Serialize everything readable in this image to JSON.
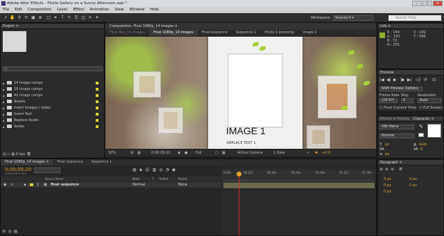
{
  "app": {
    "title": "Adobe After Effects - Photo Gallery on a Sunny Afternoon.aep *",
    "logo_text": "Ae",
    "window_buttons": [
      "–",
      "□",
      "✕"
    ]
  },
  "menu": [
    "File",
    "Edit",
    "Composition",
    "Layer",
    "Effect",
    "Animation",
    "View",
    "Window",
    "Help"
  ],
  "toolbar": {
    "tools": [
      "arrow-tool-icon",
      "hand-tool-icon",
      "zoom-tool-icon",
      "rotate-tool-icon",
      "camera-tool-icon",
      "pan-tool-icon",
      "rect-tool-icon",
      "pen-tool-icon",
      "type-tool-icon",
      "brush-tool-icon",
      "clone-tool-icon",
      "eraser-tool-icon",
      "roto-tool-icon",
      "puppet-tool-icon"
    ],
    "workspace_label": "Workspace:",
    "workspace_value": "Standard",
    "search_placeholder": "Search Help"
  },
  "project": {
    "tab": "Project ×",
    "items": [
      {
        "label": "14 image comps",
        "type": "folder"
      },
      {
        "label": "28 image comps",
        "type": "folder"
      },
      {
        "label": "42 image comps",
        "type": "folder"
      },
      {
        "label": "Assets",
        "type": "folder"
      },
      {
        "label": "Insert Images / video",
        "type": "folder"
      },
      {
        "label": "Insert Text",
        "type": "folder"
      },
      {
        "label": "Replace Audio",
        "type": "folder"
      },
      {
        "label": "Solids",
        "type": "folder"
      }
    ],
    "bpc": "8 bpc"
  },
  "composition": {
    "panel_tab": "Composition: Final 1080p_14 images ×",
    "tabs": [
      {
        "label": "Final 4kp_14 images",
        "active": false
      },
      {
        "label": "Final 1080p_14 images",
        "active": true
      },
      {
        "label": "Final sequence",
        "active": false
      },
      {
        "label": "Sequence 1",
        "active": false
      },
      {
        "label": "Photo 1 precomp",
        "active": false
      },
      {
        "label": "Image 1",
        "active": false
      }
    ],
    "image_title": "IMAGE 1",
    "image_subtitle": "REPLACE TEXT 1",
    "viewer_bar": {
      "zoom": "50%",
      "timecode": "0;00;09;20",
      "resolution": "Full",
      "camera": "Active Camera",
      "views": "1 View",
      "offset": "+0.0"
    }
  },
  "info": {
    "tab": "Info ×",
    "r": "R : 144",
    "g": "G : 150",
    "b": "B : 53",
    "a": "A : 255",
    "x": "X : 182",
    "y": "Y : 596",
    "swatch_color": "#90ae38"
  },
  "preview": {
    "tab": "Preview",
    "buttons": [
      "|◀",
      "◀|",
      "▶",
      "|▶",
      "▶|",
      "◁)",
      "⟳",
      "⊡"
    ],
    "ram_options": "RAM Preview Options",
    "frame_rate_label": "Frame Rate",
    "skip_label": "Skip",
    "resolution_label": "Resolution",
    "frame_rate_value": "(29.97)",
    "skip_value": "0",
    "resolution_value": "Auto",
    "from_current": "From Current Time",
    "full_screen": "Full Screen"
  },
  "character": {
    "tabs": [
      "Effects & Presets",
      "Character ×"
    ],
    "font": "VNI-Halve",
    "style": "Normal",
    "size": "px",
    "leading": "Auto",
    "tracking": "0",
    "stroke": "px"
  },
  "paragraph": {
    "tab": "Paragraph ×",
    "indent_values": [
      "0 px",
      "0 px",
      "0 px",
      "0 px",
      "0 px"
    ]
  },
  "timeline": {
    "tabs": [
      {
        "label": "Final 1080p_14 images ×",
        "active": true
      },
      {
        "label": "Final sequence",
        "active": false
      },
      {
        "label": "Sequence 1",
        "active": false
      }
    ],
    "timecode": "0;00;09;20",
    "fps": "00290 (29.97 fps)",
    "columns": [
      "Source Name",
      "Mode",
      "T",
      "TrkMat",
      "Parent"
    ],
    "layer": {
      "number": "1",
      "name": "final sequence",
      "mode": "Normal",
      "parent": "None"
    },
    "ruler_ticks": [
      "0:00s",
      "00:15s",
      "00:30s",
      "00:45s",
      "01:00s",
      "01:15s",
      "01:30s"
    ]
  }
}
